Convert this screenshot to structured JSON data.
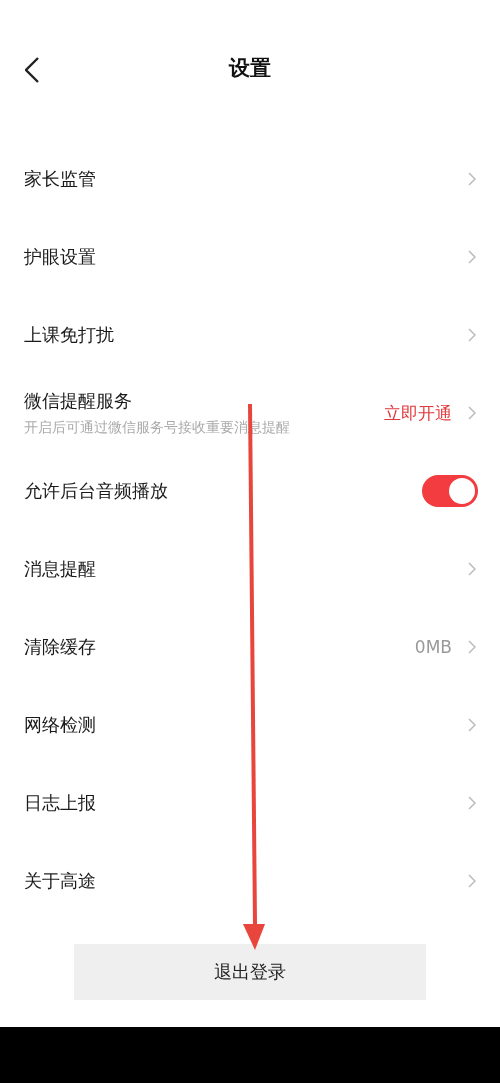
{
  "header": {
    "title": "设置"
  },
  "rows": [
    {
      "kind": "link",
      "label": "家长监管"
    },
    {
      "kind": "link",
      "label": "护眼设置"
    },
    {
      "kind": "link",
      "label": "上课免打扰"
    },
    {
      "kind": "action",
      "label": "微信提醒服务",
      "subtitle": "开启后可通过微信服务号接收重要消息提醒",
      "action": "立即开通"
    },
    {
      "kind": "toggle",
      "label": "允许后台音频播放",
      "on": true
    },
    {
      "kind": "link",
      "label": "消息提醒"
    },
    {
      "kind": "value",
      "label": "清除缓存",
      "value": "0MB"
    },
    {
      "kind": "link",
      "label": "网络检测"
    },
    {
      "kind": "link",
      "label": "日志上报"
    },
    {
      "kind": "link",
      "label": "关于高途"
    }
  ],
  "logout_button": "退出登录"
}
